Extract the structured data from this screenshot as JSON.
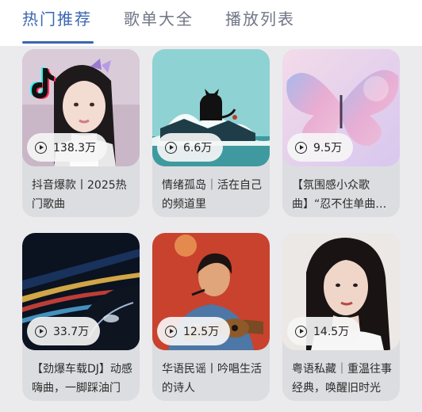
{
  "tabs": [
    {
      "label": "热门推荐",
      "active": true
    },
    {
      "label": "歌单大全",
      "active": false
    },
    {
      "label": "播放列表",
      "active": false
    }
  ],
  "colors": {
    "accent": "#3a66b0",
    "background": "#ebebed",
    "card": "#dcdde0"
  },
  "playlists": [
    {
      "plays": "138.3万",
      "title": "抖音爆款丨2025热门歌曲",
      "cover": "girl-portrait-with-tiktok-logo"
    },
    {
      "plays": "6.6万",
      "title": "情绪孤岛｜活在自己的频道里",
      "cover": "cat-on-rock-by-sea"
    },
    {
      "plays": "9.5万",
      "title": "【氛围感小众歌曲】“忍不住单曲循环",
      "cover": "pastel-butterfly"
    },
    {
      "plays": "33.7万",
      "title": "【劲爆车载DJ】动感嗨曲，一脚踩油门",
      "cover": "car-night-light-trails"
    },
    {
      "plays": "12.5万",
      "title": "华语民谣丨吟唱生活的诗人",
      "cover": "guitarist-illustration"
    },
    {
      "plays": "14.5万",
      "title": "粤语私藏｜重温往事经典，唤醒旧时光",
      "cover": "vintage-woman-portrait"
    }
  ]
}
